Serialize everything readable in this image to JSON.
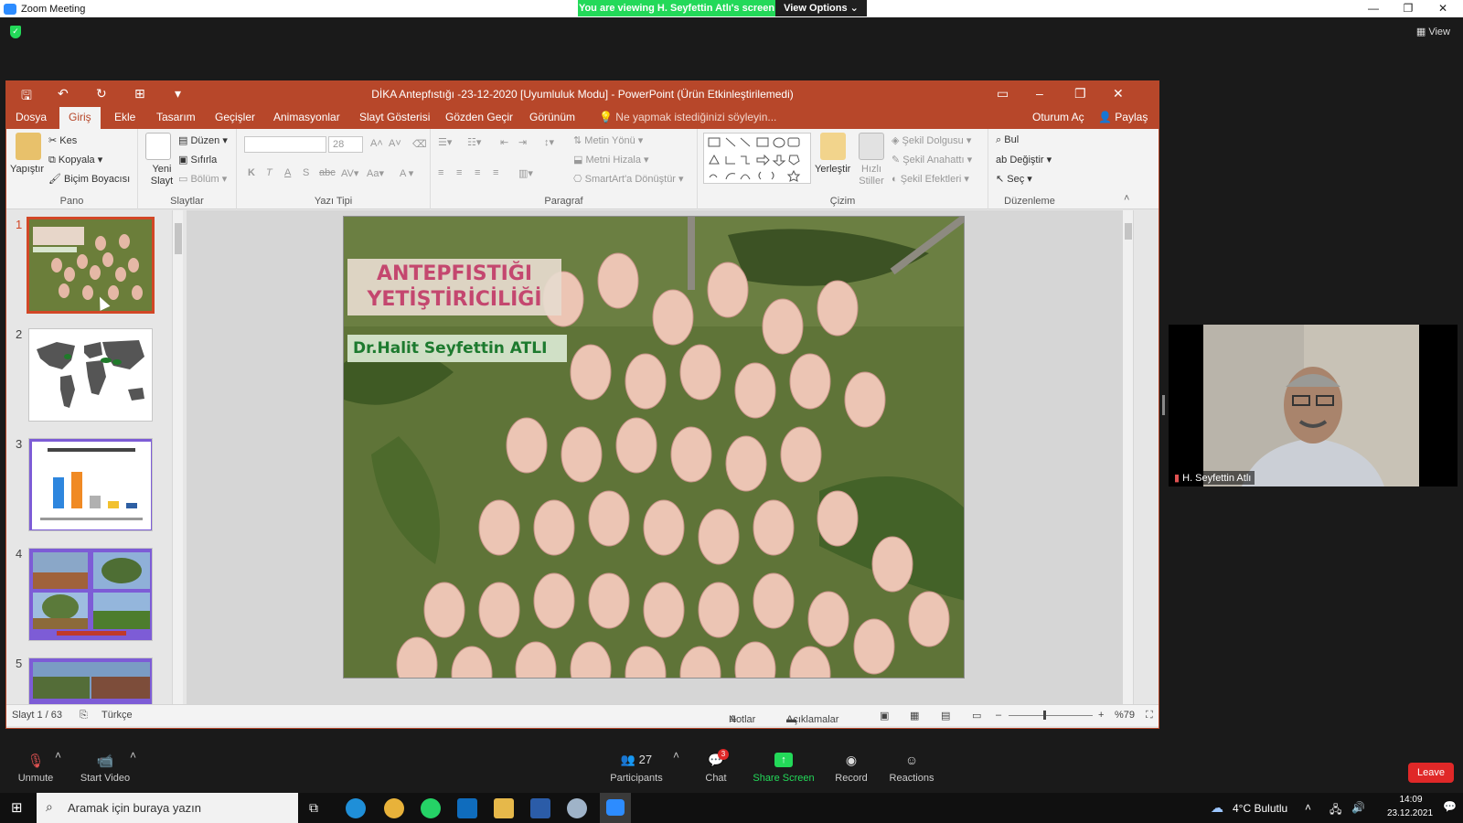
{
  "zoom": {
    "window_title": "Zoom Meeting",
    "viewing_banner": "You are viewing H. Seyfettin Atlı's screen",
    "view_options": "View Options",
    "view_button": "View",
    "participant_name": "H. Seyfettin Atlı",
    "participants_count": "27",
    "chat_badge": "3",
    "toolbar": {
      "unmute": "Unmute",
      "start_video": "Start Video",
      "participants": "Participants",
      "chat": "Chat",
      "share_screen": "Share Screen",
      "record": "Record",
      "reactions": "Reactions",
      "leave": "Leave"
    }
  },
  "ppt": {
    "title": "DİKA Antepfıstığı -23-12-2020 [Uyumluluk Modu] - PowerPoint (Ürün Etkinleştirilemedi)",
    "tabs": [
      "Dosya",
      "Giriş",
      "Ekle",
      "Tasarım",
      "Geçişler",
      "Animasyonlar",
      "Slayt Gösterisi",
      "Gözden Geçir",
      "Görünüm"
    ],
    "tell_me": "Ne yapmak istediğinizi söyleyin...",
    "sign_in": "Oturum Aç",
    "share": "Paylaş",
    "ribbon": {
      "pano": {
        "label": "Pano",
        "paste": "Yapıştır",
        "cut": "Kes",
        "copy": "Kopyala",
        "format_painter": "Biçim Boyacısı"
      },
      "slaytlar": {
        "label": "Slaytlar",
        "new_slide": "Yeni Slayt",
        "layout": "Düzen",
        "reset": "Sıfırla",
        "section": "Bölüm"
      },
      "yazi_tipi": {
        "label": "Yazı Tipi",
        "font_size": "28"
      },
      "paragraf": {
        "label": "Paragraf",
        "text_direction": "Metin Yönü",
        "align_text": "Metni Hizala",
        "smartart": "SmartArt'a Dönüştür"
      },
      "cizim": {
        "label": "Çizim",
        "arrange": "Yerleştir",
        "quick_styles": "Hızlı Stiller",
        "shape_fill": "Şekil Dolgusu",
        "shape_outline": "Şekil Anahattı",
        "shape_effects": "Şekil Efektleri"
      },
      "duzenleme": {
        "label": "Düzenleme",
        "find": "Bul",
        "replace": "Değiştir",
        "select": "Seç"
      }
    },
    "thumb_numbers": [
      "1",
      "2",
      "3",
      "4",
      "5"
    ],
    "slide": {
      "title_line1": "ANTEPFISTIĞI",
      "title_line2": "YETİŞTİRİCİLİĞİ",
      "author": "Dr.Halit Seyfettin ATLI"
    },
    "status": {
      "slide_count": "Slayt 1 / 63",
      "language": "Türkçe",
      "notes": "Notlar",
      "comments": "Açıklamalar",
      "zoom": "%79"
    }
  },
  "taskbar": {
    "search_placeholder": "Aramak için buraya yazın",
    "weather": "4°C  Bulutlu",
    "time": "14:09",
    "date": "23.12.2021"
  },
  "colors": {
    "ppt_accent": "#b7472a",
    "zoom_green": "#23d959",
    "leave_red": "#e02828"
  }
}
